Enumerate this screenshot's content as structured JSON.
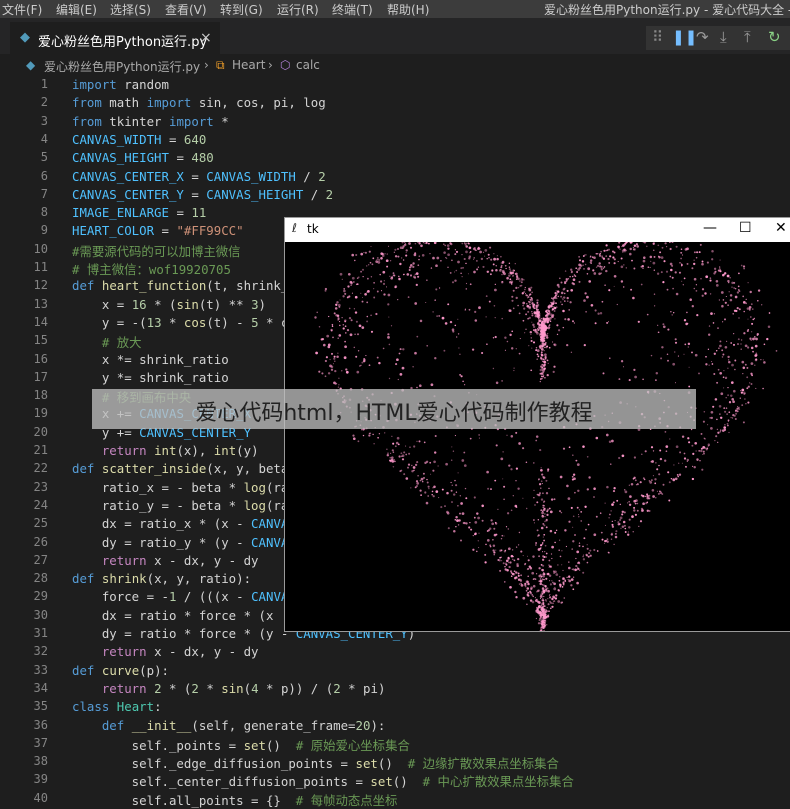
{
  "menubar": {
    "items": [
      "文件(F)",
      "编辑(E)",
      "选择(S)",
      "查看(V)",
      "转到(G)",
      "运行(R)",
      "终端(T)",
      "帮助(H)"
    ],
    "window_title": "爱心粉丝色用Python运行.py - 爱心代码大全 - Vi"
  },
  "tab": {
    "label": "爱心粉丝色用Python运行.py",
    "icon": "python-file-icon",
    "close": "×"
  },
  "debug_toolbar": {
    "icons": [
      "grip-icon",
      "pause-icon",
      "step-over-icon",
      "step-into-icon",
      "step-out-icon",
      "restart-icon"
    ]
  },
  "breadcrumb": {
    "file": "爱心粉丝色用Python运行.py",
    "class": "Heart",
    "method": "calc"
  },
  "code_lines": [
    [
      [
        "import",
        "kw"
      ],
      [
        " random",
        "t"
      ]
    ],
    [
      [
        "from",
        "kw"
      ],
      [
        " math ",
        "t"
      ],
      [
        "import",
        "kw"
      ],
      [
        " sin, cos, pi, log",
        "t"
      ]
    ],
    [
      [
        "from",
        "kw"
      ],
      [
        " tkinter ",
        "t"
      ],
      [
        "import",
        "kw"
      ],
      [
        " *",
        "t"
      ]
    ],
    [
      [
        "CANVAS_WIDTH",
        "c"
      ],
      [
        " = ",
        "t"
      ],
      [
        "640",
        "n"
      ]
    ],
    [
      [
        "CANVAS_HEIGHT",
        "c"
      ],
      [
        " = ",
        "t"
      ],
      [
        "480",
        "n"
      ]
    ],
    [
      [
        "CANVAS_CENTER_X",
        "c"
      ],
      [
        " = ",
        "t"
      ],
      [
        "CANVAS_WIDTH",
        "c"
      ],
      [
        " / ",
        "t"
      ],
      [
        "2",
        "n"
      ]
    ],
    [
      [
        "CANVAS_CENTER_Y",
        "c"
      ],
      [
        " = ",
        "t"
      ],
      [
        "CANVAS_HEIGHT",
        "c"
      ],
      [
        " / ",
        "t"
      ],
      [
        "2",
        "n"
      ]
    ],
    [
      [
        "IMAGE_ENLARGE",
        "c"
      ],
      [
        " = ",
        "t"
      ],
      [
        "11",
        "n"
      ]
    ],
    [
      [
        "HEART_COLOR",
        "c"
      ],
      [
        " = ",
        "t"
      ],
      [
        "\"#FF99CC\"",
        "s"
      ]
    ],
    [
      [
        "#需要源代码的可以加博主微信",
        "cm"
      ]
    ],
    [
      [
        "# 博主微信：wof19920705",
        "cm"
      ]
    ],
    [
      [
        "def",
        "kw"
      ],
      [
        " ",
        "t"
      ],
      [
        "heart_function",
        "f"
      ],
      [
        "(t, shrink_",
        "t"
      ]
    ],
    [
      [
        "    x = ",
        "t"
      ],
      [
        "16",
        "n"
      ],
      [
        " * (",
        "t"
      ],
      [
        "sin",
        "f"
      ],
      [
        "(t) ** ",
        "t"
      ],
      [
        "3",
        "n"
      ],
      [
        ")",
        "t"
      ]
    ],
    [
      [
        "    y = -(",
        "t"
      ],
      [
        "13",
        "n"
      ],
      [
        " * ",
        "t"
      ],
      [
        "cos",
        "f"
      ],
      [
        "(t) - ",
        "t"
      ],
      [
        "5",
        "n"
      ],
      [
        " * c",
        "t"
      ]
    ],
    [
      [
        "    # 放大",
        "cm"
      ]
    ],
    [
      [
        "    x *= shrink_ratio",
        "t"
      ]
    ],
    [
      [
        "    y *= shrink_ratio",
        "t"
      ]
    ],
    [
      [
        "    # 移到画布中央",
        "cm"
      ]
    ],
    [
      [
        "    x += ",
        "t"
      ],
      [
        "CANVAS_CENTER_X",
        "c"
      ]
    ],
    [
      [
        "    y += ",
        "t"
      ],
      [
        "CANVAS_CENTER_Y",
        "c"
      ]
    ],
    [
      [
        "    ",
        "t"
      ],
      [
        "return",
        "kw2"
      ],
      [
        " ",
        "t"
      ],
      [
        "int",
        "f"
      ],
      [
        "(x), ",
        "t"
      ],
      [
        "int",
        "f"
      ],
      [
        "(y)",
        "t"
      ]
    ],
    [
      [
        "def",
        "kw"
      ],
      [
        " ",
        "t"
      ],
      [
        "scatter_inside",
        "f"
      ],
      [
        "(x, y, beta",
        "t"
      ]
    ],
    [
      [
        "    ratio_x = - beta * ",
        "t"
      ],
      [
        "log",
        "f"
      ],
      [
        "(ra",
        "t"
      ]
    ],
    [
      [
        "    ratio_y = - beta * ",
        "t"
      ],
      [
        "log",
        "f"
      ],
      [
        "(ra",
        "t"
      ]
    ],
    [
      [
        "    dx = ratio_x * (x - ",
        "t"
      ],
      [
        "CANVA",
        "c"
      ]
    ],
    [
      [
        "    dy = ratio_y * (y - ",
        "t"
      ],
      [
        "CANVA",
        "c"
      ]
    ],
    [
      [
        "    ",
        "t"
      ],
      [
        "return",
        "kw2"
      ],
      [
        " x - dx, y - dy",
        "t"
      ]
    ],
    [
      [
        "def",
        "kw"
      ],
      [
        " ",
        "t"
      ],
      [
        "shrink",
        "f"
      ],
      [
        "(x, y, ratio):",
        "t"
      ]
    ],
    [
      [
        "    force = -",
        "t"
      ],
      [
        "1",
        "n"
      ],
      [
        " / (((x - ",
        "t"
      ],
      [
        "CANVA",
        "c"
      ]
    ],
    [
      [
        "    dx = ratio * force * (x",
        "t"
      ]
    ],
    [
      [
        "    dy = ratio * force * (y - ",
        "t"
      ],
      [
        "CANVAS_CENTER_Y",
        "c"
      ],
      [
        ")",
        "t"
      ]
    ],
    [
      [
        "    ",
        "t"
      ],
      [
        "return",
        "kw2"
      ],
      [
        " x - dx, y - dy",
        "t"
      ]
    ],
    [
      [
        "def",
        "kw"
      ],
      [
        " ",
        "t"
      ],
      [
        "curve",
        "f"
      ],
      [
        "(p):",
        "t"
      ]
    ],
    [
      [
        "    ",
        "t"
      ],
      [
        "return",
        "kw2"
      ],
      [
        " ",
        "t"
      ],
      [
        "2",
        "n"
      ],
      [
        " * (",
        "t"
      ],
      [
        "2",
        "n"
      ],
      [
        " * ",
        "t"
      ],
      [
        "sin",
        "f"
      ],
      [
        "(",
        "t"
      ],
      [
        "4",
        "n"
      ],
      [
        " * p)) / (",
        "t"
      ],
      [
        "2",
        "n"
      ],
      [
        " * pi)",
        "t"
      ]
    ],
    [
      [
        "class",
        "kw"
      ],
      [
        " ",
        "t"
      ],
      [
        "Heart",
        "cls"
      ],
      [
        ":",
        "t"
      ]
    ],
    [
      [
        "    ",
        "t"
      ],
      [
        "def",
        "kw"
      ],
      [
        " ",
        "t"
      ],
      [
        "__init__",
        "f"
      ],
      [
        "(self, generate_frame=",
        "t"
      ],
      [
        "20",
        "n"
      ],
      [
        "):",
        "t"
      ]
    ],
    [
      [
        "        self._points = ",
        "t"
      ],
      [
        "set",
        "f"
      ],
      [
        "()  ",
        "t"
      ],
      [
        "# 原始爱心坐标集合",
        "cm"
      ]
    ],
    [
      [
        "        self._edge_diffusion_points = ",
        "t"
      ],
      [
        "set",
        "f"
      ],
      [
        "()  ",
        "t"
      ],
      [
        "# 边缘扩散效果点坐标集合",
        "cm"
      ]
    ],
    [
      [
        "        self._center_diffusion_points = ",
        "t"
      ],
      [
        "set",
        "f"
      ],
      [
        "()  ",
        "t"
      ],
      [
        "# 中心扩散效果点坐标集合",
        "cm"
      ]
    ],
    [
      [
        "        self.all_points = {}  ",
        "t"
      ],
      [
        "# 每帧动态点坐标",
        "cm"
      ]
    ]
  ],
  "syntax_colors": {
    "kw": "#569cd6",
    "kw2": "#c586c0",
    "t": "#d4d4d4",
    "c": "#4fc1ff",
    "n": "#b5cea8",
    "s": "#ce9178",
    "cm": "#6a9955",
    "f": "#dcdcaa",
    "cls": "#4ec9b0"
  },
  "tk_window": {
    "title": "tk",
    "minimize": "—",
    "maximize": "☐",
    "close": "✕",
    "heart_color": "#FF99CC"
  },
  "overlay": {
    "text": "爱心代码html，HTML爱心代码制作教程"
  }
}
